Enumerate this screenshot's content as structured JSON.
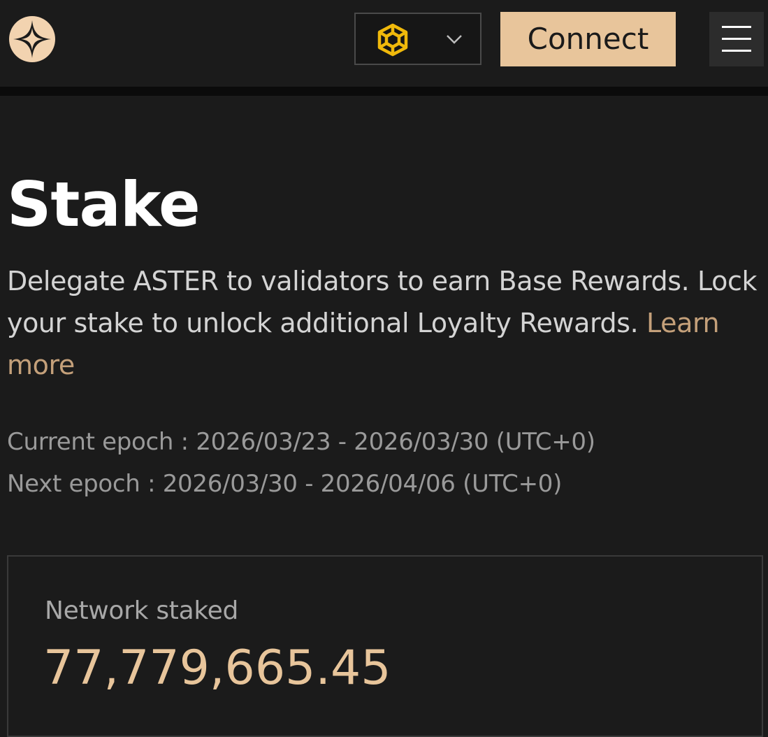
{
  "header": {
    "network": {
      "selected_icon": "bnb-chain-icon",
      "dropdown_icon": "chevron-down-icon"
    },
    "connect_label": "Connect",
    "menu_icon": "hamburger-menu-icon",
    "logo_icon": "aster-logo-icon"
  },
  "main": {
    "title": "Stake",
    "description": "Delegate ASTER to validators to earn Base Rewards. Lock your stake to unlock additional Loyalty Rewards.",
    "learn_more_label": "Learn more",
    "current_epoch": "Current epoch : 2026/03/23 - 2026/03/30 (UTC+0)",
    "next_epoch": "Next epoch : 2026/03/30 - 2026/04/06 (UTC+0)"
  },
  "stats": {
    "network_staked_label": "Network staked",
    "network_staked_value": "77,779,665.45"
  },
  "colors": {
    "background": "#1b1b1b",
    "accent": "#e8c59b",
    "link": "#c4a07a",
    "bnb_yellow": "#f0b90b"
  }
}
